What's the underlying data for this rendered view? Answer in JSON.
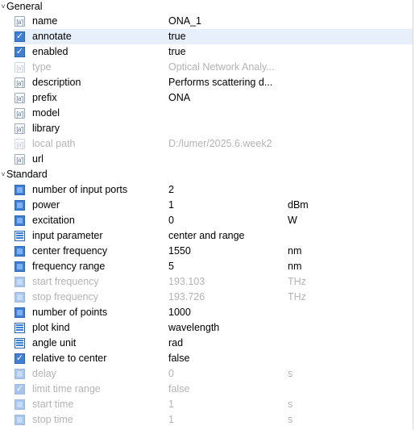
{
  "groups": {
    "general": {
      "label": "General",
      "expanded_icon": "chevron-down-icon"
    },
    "standard": {
      "label": "Standard",
      "expanded_icon": "chevron-down-icon"
    }
  },
  "general": [
    {
      "name": "name",
      "value": "ONA_1",
      "unit": "",
      "icon": "text-icon",
      "icon_text": "[a']"
    },
    {
      "name": "annotate",
      "value": "true",
      "unit": "",
      "icon": "checkbox-icon",
      "icon_text": "✓"
    },
    {
      "name": "enabled",
      "value": "true",
      "unit": "",
      "icon": "checkbox-icon",
      "icon_text": "✓"
    },
    {
      "name": "type",
      "value": "Optical Network Analy...",
      "unit": "",
      "icon": "text-icon",
      "icon_text": "[a']"
    },
    {
      "name": "description",
      "value": "Performs scattering d...",
      "unit": "",
      "icon": "text-icon",
      "icon_text": "[a']"
    },
    {
      "name": "prefix",
      "value": "ONA",
      "unit": "",
      "icon": "text-icon",
      "icon_text": "[a']"
    },
    {
      "name": "model",
      "value": "",
      "unit": "",
      "icon": "text-icon",
      "icon_text": "[a']"
    },
    {
      "name": "library",
      "value": "",
      "unit": "",
      "icon": "text-icon",
      "icon_text": "[a']"
    },
    {
      "name": "local path",
      "value": "D:/lumer/2025.6.week2",
      "unit": "",
      "icon": "text-icon",
      "icon_text": "[a']"
    },
    {
      "name": "url",
      "value": "",
      "unit": "",
      "icon": "text-icon",
      "icon_text": "[a']"
    }
  ],
  "standard": [
    {
      "name": "number of input ports",
      "value": "2",
      "unit": "",
      "icon": "number-icon"
    },
    {
      "name": "power",
      "value": "1",
      "unit": "dBm",
      "icon": "number-icon"
    },
    {
      "name": "excitation",
      "value": "0",
      "unit": "W",
      "icon": "number-icon"
    },
    {
      "name": "input parameter",
      "value": "center and range",
      "unit": "",
      "icon": "list-icon"
    },
    {
      "name": "center frequency",
      "value": "1550",
      "unit": "nm",
      "icon": "number-icon"
    },
    {
      "name": "frequency range",
      "value": "5",
      "unit": "nm",
      "icon": "number-icon"
    },
    {
      "name": "start frequency",
      "value": "193.103",
      "unit": "THz",
      "icon": "number-icon"
    },
    {
      "name": "stop frequency",
      "value": "193.726",
      "unit": "THz",
      "icon": "number-icon"
    },
    {
      "name": "number of points",
      "value": "1000",
      "unit": "",
      "icon": "number-icon"
    },
    {
      "name": "plot kind",
      "value": "wavelength",
      "unit": "",
      "icon": "list-icon"
    },
    {
      "name": "angle unit",
      "value": "rad",
      "unit": "",
      "icon": "list-icon"
    },
    {
      "name": "relative to center",
      "value": "false",
      "unit": "",
      "icon": "checkbox-icon",
      "icon_text": "✓"
    },
    {
      "name": "delay",
      "value": "0",
      "unit": "s",
      "icon": "number-icon"
    },
    {
      "name": "limit time range",
      "value": "false",
      "unit": "",
      "icon": "checkbox-icon",
      "icon_text": "✓"
    },
    {
      "name": "start time",
      "value": "1",
      "unit": "s",
      "icon": "number-icon"
    },
    {
      "name": "stop time",
      "value": "1",
      "unit": "s",
      "icon": "number-icon"
    }
  ],
  "colors": {
    "selected_row": "#e6effa",
    "disabled_text": "#b4b4b4",
    "icon_blue": "#3f7fd6"
  }
}
